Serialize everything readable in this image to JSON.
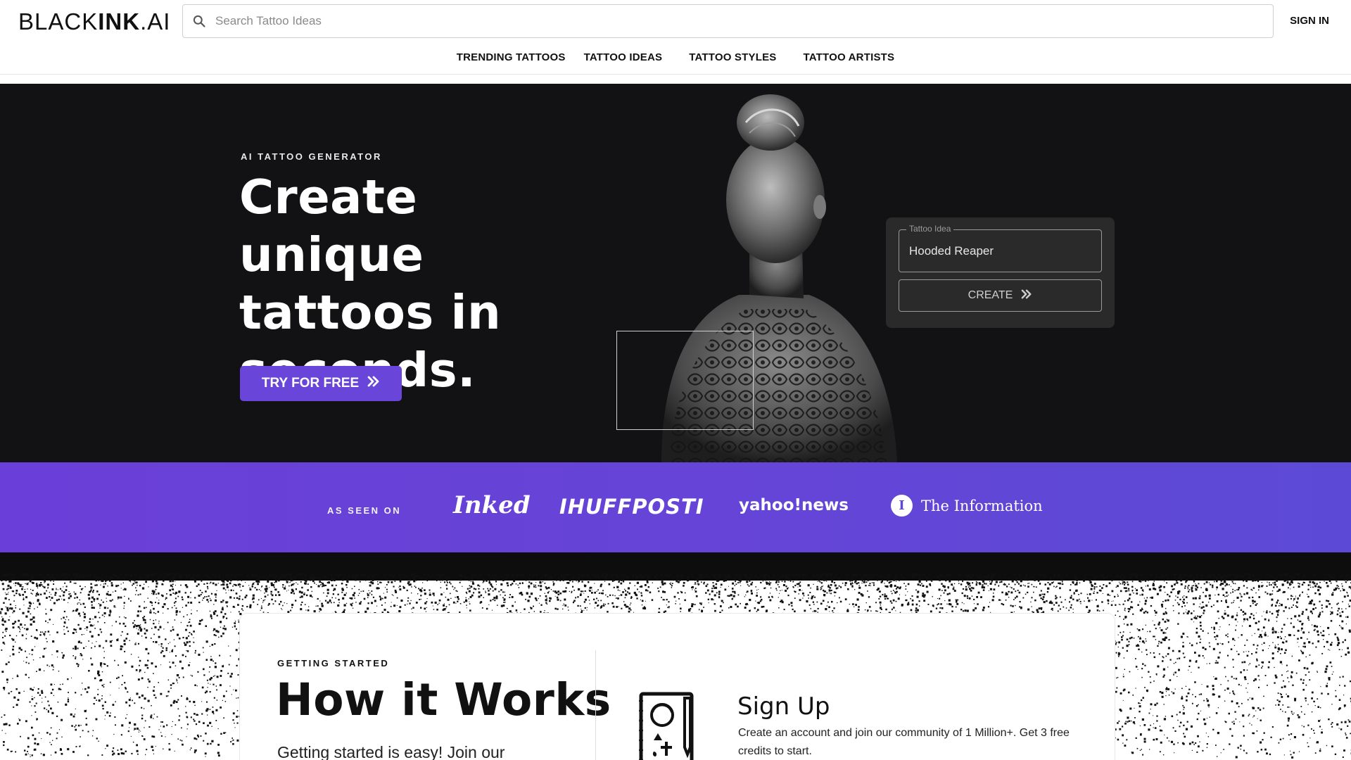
{
  "header": {
    "logo_thin": "BLACK",
    "logo_bold": "INK",
    "logo_suffix": ".AI",
    "search_placeholder": "Search Tattoo Ideas",
    "search_icon": "search-icon",
    "signin_label": "SIGN IN"
  },
  "nav": {
    "items": [
      "TRENDING TATTOOS",
      "TATTOO IDEAS",
      "TATTOO STYLES",
      "TATTOO ARTISTS"
    ]
  },
  "hero": {
    "eyebrow": "AI TATTOO GENERATOR",
    "title": "Create unique tattoos in seconds.",
    "cta_label": "TRY FOR FREE",
    "cta_icon": "double-chevron-right-icon"
  },
  "generator": {
    "field_label": "Tattoo Idea",
    "field_value": "Hooded Reaper",
    "button_label": "CREATE",
    "button_icon": "double-chevron-right-icon"
  },
  "press": {
    "label": "AS SEEN ON",
    "logos": [
      "Inked",
      "IHUFFPOSTI",
      "yahoo!news",
      "The Information"
    ]
  },
  "how_it_works": {
    "eyebrow": "GETTING STARTED",
    "title": "How it Works",
    "text": "Getting started is easy! Join our",
    "step": {
      "title": "Sign Up",
      "text": "Create an account and join our community of 1 Million+. Get 3 free credits to start."
    }
  },
  "colors": {
    "accent": "#6a45d9",
    "hero_bg": "#121113",
    "card_bg": "#2a2a2b"
  }
}
